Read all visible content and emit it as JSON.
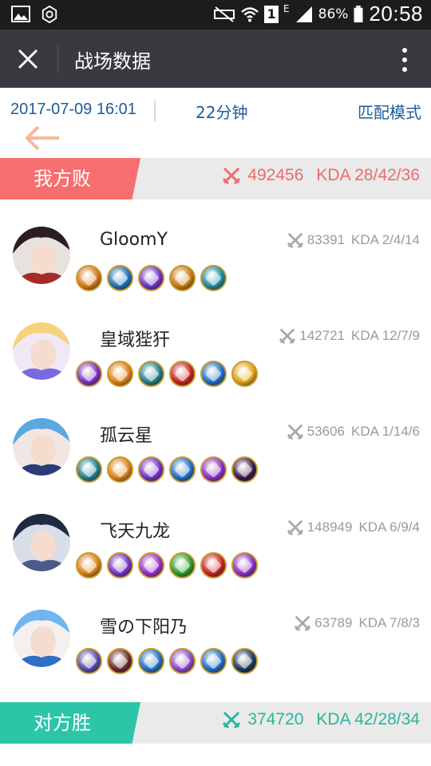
{
  "status_bar": {
    "sim": "1",
    "network": "E",
    "battery": "86%",
    "time": "20:58"
  },
  "titlebar": {
    "title": "战场数据"
  },
  "match": {
    "datetime": "2017-07-09 16:01",
    "duration": "22分钟",
    "mode": "匹配模式"
  },
  "our_team": {
    "result": "我方败",
    "score": "492456",
    "kda": "KDA 28/42/36",
    "color": "#f76e6e"
  },
  "enemy_team": {
    "result": "对方胜",
    "score": "374720",
    "kda": "KDA 42/28/34",
    "color": "#2dc5a8"
  },
  "players": [
    {
      "name": "GloomY",
      "score": "83391",
      "kda": "KDA 2/4/14",
      "avatar_colors": [
        "#2b1d22",
        "#e8e2de",
        "#a62b2b"
      ],
      "items": [
        "#d47a1c",
        "#1f6fb6",
        "#6f33c8",
        "#c47a14",
        "#1e8aa0"
      ]
    },
    {
      "name": "皇域狴犴",
      "score": "142721",
      "kda": "KDA 12/7/9",
      "avatar_colors": [
        "#f5d37a",
        "#f0e9f5",
        "#7a6ae0"
      ],
      "items": [
        "#7a2fc4",
        "#d8841c",
        "#1f7f88",
        "#c2241f",
        "#1e6fc4",
        "#e0a51a"
      ]
    },
    {
      "name": "孤云星",
      "score": "53606",
      "kda": "KDA 1/14/6",
      "avatar_colors": [
        "#5aa8e0",
        "#f2e6e4",
        "#2c3a78"
      ],
      "items": [
        "#1f7f88",
        "#d8841c",
        "#6f33c8",
        "#1e6fc4",
        "#8a2fc2",
        "#3a1a4a"
      ]
    },
    {
      "name": "飞天九龙",
      "score": "148949",
      "kda": "KDA 6/9/4",
      "avatar_colors": [
        "#1f2a44",
        "#d9dde8",
        "#4b5a8a"
      ],
      "items": [
        "#d8841c",
        "#6f33c8",
        "#9a2fc4",
        "#2e9a2a",
        "#c2241f",
        "#8a2fc2"
      ]
    },
    {
      "name": "雪の下阳乃",
      "score": "63789",
      "kda": "KDA 7/8/3",
      "avatar_colors": [
        "#6fb6f0",
        "#f5f0f0",
        "#2d70c8"
      ],
      "items": [
        "#5a4aa8",
        "#6a2a2a",
        "#1e6fc4",
        "#8a4ac8",
        "#1e6fc4",
        "#1a3a5a"
      ]
    }
  ],
  "icons": {
    "status_left": [
      "image-icon",
      "settings-icon"
    ],
    "status_right": [
      "mute-icon",
      "wifi-icon",
      "signal-icon",
      "battery-icon"
    ],
    "nav": [
      "close-icon",
      "more-vertical-icon",
      "back-arrow-icon"
    ],
    "stats": "crossed-swords-icon"
  }
}
